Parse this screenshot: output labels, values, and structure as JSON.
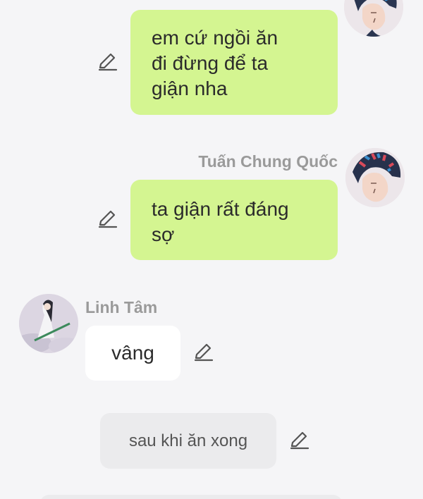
{
  "messages": [
    {
      "side": "right",
      "speaker": "",
      "lines": [
        "em cứ ngồi ăn",
        "đi đừng để ta",
        "giận nha"
      ]
    },
    {
      "side": "right",
      "speaker": "Tuấn Chung Quốc",
      "lines": [
        "ta giận rất đáng",
        "sợ"
      ]
    },
    {
      "side": "left",
      "speaker": "Linh Tâm",
      "text": "vâng"
    },
    {
      "side": "narration",
      "text": "sau khi ăn xong"
    }
  ],
  "icons": {
    "edit": "pencil-edit-icon",
    "avatar_male": "avatar-tuan-chung-quoc",
    "avatar_female": "avatar-linh-tam"
  },
  "colors": {
    "background": "#f5f5f7",
    "bubble_self": "#d4f591",
    "bubble_other": "#ffffff",
    "bubble_narration": "#ebebed",
    "name_text": "#9a9a9a"
  }
}
